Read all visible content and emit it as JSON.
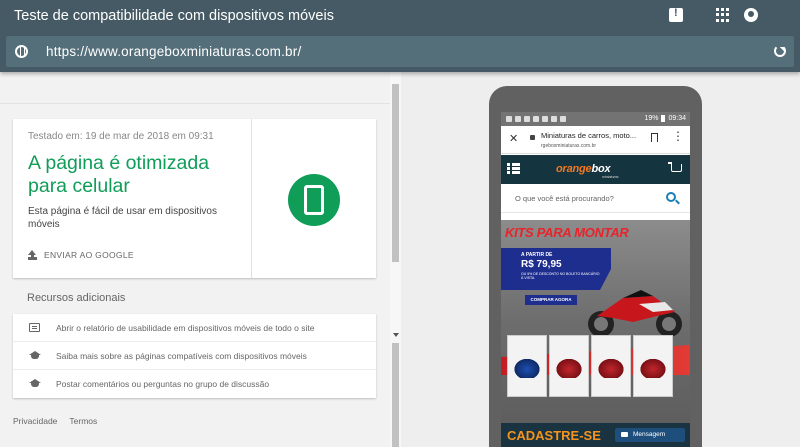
{
  "app": {
    "title": "Teste de compatibilidade com dispositivos móveis",
    "url": "https://www.orangeboxminiaturas.com.br/"
  },
  "result": {
    "tested_on": "Testado em: 19 de mar de 2018 em 09:31",
    "headline": "A página é otimizada para celular",
    "description": "Esta página é fácil de usar em dispositivos móveis",
    "send_label": "ENVIAR AO GOOGLE"
  },
  "resources": {
    "title": "Recursos adicionais",
    "items": [
      {
        "label": "Abrir o relatório de usabilidade em dispositivos móveis de todo o site",
        "icon": "report-icon"
      },
      {
        "label": "Saiba mais sobre as páginas compatíveis com dispositivos móveis",
        "icon": "school-icon"
      },
      {
        "label": "Postar comentários ou perguntas no grupo de discussão",
        "icon": "school-icon"
      }
    ]
  },
  "footer": {
    "privacy": "Privacidade",
    "terms": "Termos"
  },
  "phone": {
    "status_battery": "19%",
    "status_time": "09:34",
    "tab_title": "Miniaturas de carros, moto...",
    "tab_url": "rgeboxminiaturas.com.br",
    "logo_orange": "orange",
    "logo_white": "box",
    "logo_sub": "miniaturas",
    "search_placeholder": "O que você está procurando?",
    "banner_title": "KITS PARA MONTAR",
    "banner_price_prefix": "A PARTIR DE",
    "banner_price": "R$ 79,95",
    "banner_note": "OU 5% DE DESCONTO NO BOLETO BANCÁRIO À VISTA.",
    "banner_cta": "COMPRAR AGORA",
    "cadastre": "CADASTRE-SE",
    "message_button": "Mensagem"
  },
  "colors": {
    "appbar": "#455a64",
    "success_green": "#0f9d58",
    "brand_orange": "#f47920"
  }
}
